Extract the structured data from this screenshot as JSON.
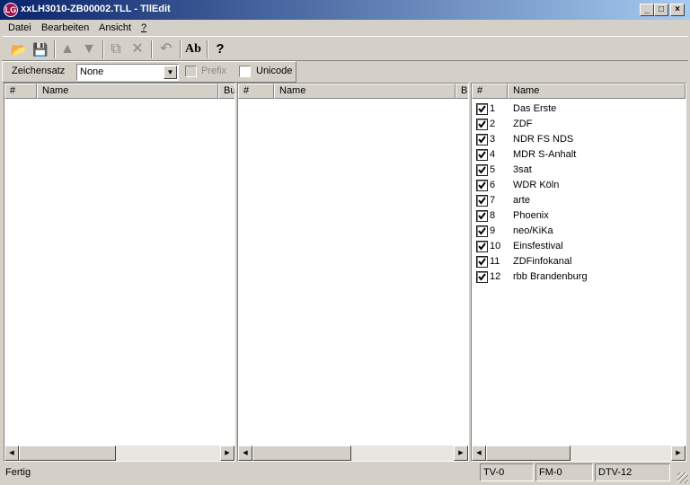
{
  "window": {
    "title": "xxLH3010-ZB00002.TLL - TllEdit",
    "app_icon_text": "LG",
    "min_label": "_",
    "max_label": "□",
    "close_label": "×"
  },
  "menu": [
    "Datei",
    "Bearbeiten",
    "Ansicht",
    "?"
  ],
  "toolbar": {
    "open_icon": "📂",
    "save_icon": "💾",
    "up_icon": "▲",
    "down_icon": "▼",
    "copy_icon": "⧉",
    "delete_icon": "✕",
    "undo_icon": "↶",
    "font_label": "Ab",
    "help_icon": "?"
  },
  "options": {
    "charset_label": "Zeichensatz",
    "charset_value": "None",
    "prefix_label": "Prefix",
    "unicode_label": "Unicode"
  },
  "panels": [
    {
      "headers": [
        "#",
        "Name",
        "Bu"
      ]
    },
    {
      "headers": [
        "#",
        "Name",
        "Bu"
      ]
    },
    {
      "headers": [
        "#",
        "Name"
      ],
      "rows": [
        {
          "num": "1",
          "name": "Das Erste"
        },
        {
          "num": "2",
          "name": "ZDF"
        },
        {
          "num": "3",
          "name": "NDR FS NDS"
        },
        {
          "num": "4",
          "name": "MDR S-Anhalt"
        },
        {
          "num": "5",
          "name": "3sat"
        },
        {
          "num": "6",
          "name": "WDR Köln"
        },
        {
          "num": "7",
          "name": "arte"
        },
        {
          "num": "8",
          "name": "Phoenix"
        },
        {
          "num": "9",
          "name": "neo/KiKa"
        },
        {
          "num": "10",
          "name": "Einsfestival"
        },
        {
          "num": "11",
          "name": "ZDFinfokanal"
        },
        {
          "num": "12",
          "name": "rbb Brandenburg"
        }
      ]
    }
  ],
  "scroll": {
    "left_arrow": "◀",
    "right_arrow": "▶"
  },
  "status": {
    "text": "Fertig",
    "tv": "TV-0",
    "fm": "FM-0",
    "dtv": "DTV-12"
  }
}
